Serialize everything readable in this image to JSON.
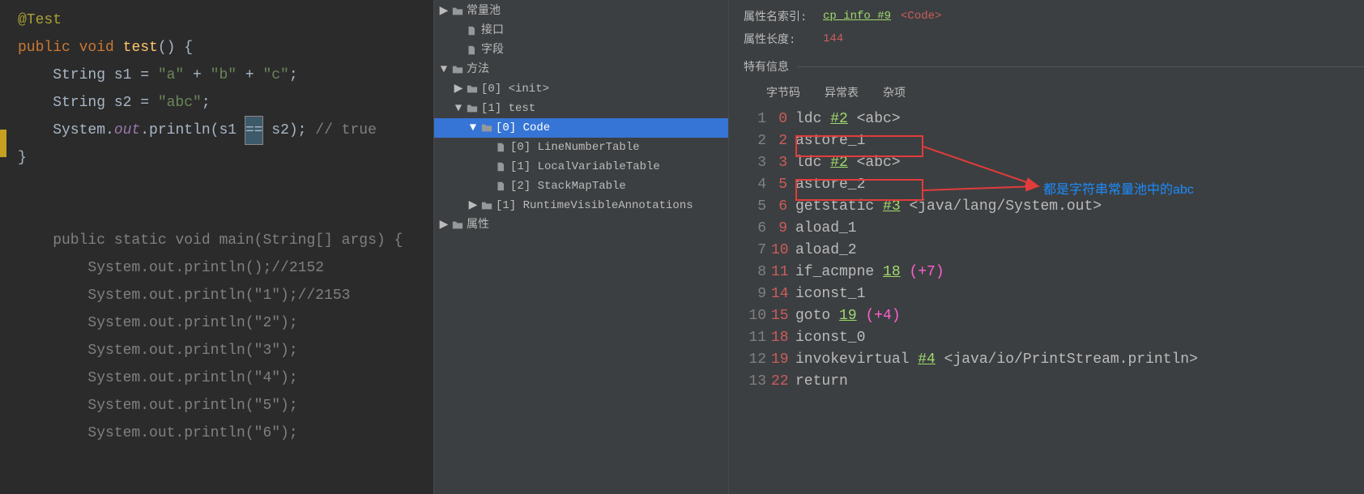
{
  "editor": {
    "lines": [
      {
        "tokens": [
          [
            "anno",
            "@Test"
          ]
        ]
      },
      {
        "tokens": [
          [
            "kw",
            "public "
          ],
          [
            "kw",
            "void "
          ],
          [
            "id",
            "test"
          ],
          [
            "punct",
            "() {"
          ]
        ]
      },
      {
        "tokens": [
          [
            "punct",
            "    String s1 = "
          ],
          [
            "str",
            "\"a\""
          ],
          [
            "punct",
            " + "
          ],
          [
            "str",
            "\"b\""
          ],
          [
            "punct",
            " + "
          ],
          [
            "str",
            "\"c\""
          ],
          [
            "punct",
            ";"
          ]
        ]
      },
      {
        "tokens": [
          [
            "punct",
            "    String s2 = "
          ],
          [
            "str",
            "\"abc\""
          ],
          [
            "punct",
            ";"
          ]
        ]
      },
      {
        "tokens": [
          [
            "punct",
            "    System."
          ],
          [
            "field",
            "out"
          ],
          [
            "punct",
            ".println(s1 "
          ],
          [
            "cursor",
            "=="
          ],
          [
            "punct",
            " s2); "
          ],
          [
            "comment",
            "// true"
          ]
        ]
      },
      {
        "tokens": [
          [
            "punct",
            "}"
          ]
        ]
      },
      {
        "tokens": []
      },
      {
        "tokens": []
      },
      {
        "tokens": [
          [
            "comment",
            "    public static void main(String[] args) {"
          ]
        ]
      },
      {
        "tokens": [
          [
            "comment",
            "        System.out.println();//2152"
          ]
        ]
      },
      {
        "tokens": [
          [
            "comment",
            "        System.out.println(\"1\");//2153"
          ]
        ]
      },
      {
        "tokens": [
          [
            "comment",
            "        System.out.println(\"2\");"
          ]
        ]
      },
      {
        "tokens": [
          [
            "comment",
            "        System.out.println(\"3\");"
          ]
        ]
      },
      {
        "tokens": [
          [
            "comment",
            "        System.out.println(\"4\");"
          ]
        ]
      },
      {
        "tokens": [
          [
            "comment",
            "        System.out.println(\"5\");"
          ]
        ]
      },
      {
        "tokens": [
          [
            "comment",
            "        System.out.println(\"6\");"
          ]
        ]
      }
    ]
  },
  "tree": {
    "items": [
      {
        "depth": 1,
        "arrow": "▶",
        "icon": "folder",
        "label": "常量池",
        "selected": false
      },
      {
        "depth": 2,
        "arrow": "",
        "icon": "file",
        "label": "接口",
        "selected": false
      },
      {
        "depth": 2,
        "arrow": "",
        "icon": "file",
        "label": "字段",
        "selected": false
      },
      {
        "depth": 1,
        "arrow": "▼",
        "icon": "folder",
        "label": "方法",
        "selected": false
      },
      {
        "depth": 2,
        "arrow": "▶",
        "icon": "folder",
        "label": "[0] <init>",
        "selected": false
      },
      {
        "depth": 2,
        "arrow": "▼",
        "icon": "folder",
        "label": "[1] test",
        "selected": false
      },
      {
        "depth": 3,
        "arrow": "▼",
        "icon": "folder",
        "label": "[0] Code",
        "selected": true
      },
      {
        "depth": 4,
        "arrow": "",
        "icon": "file",
        "label": "[0] LineNumberTable",
        "selected": false
      },
      {
        "depth": 4,
        "arrow": "",
        "icon": "file",
        "label": "[1] LocalVariableTable",
        "selected": false
      },
      {
        "depth": 4,
        "arrow": "",
        "icon": "file",
        "label": "[2] StackMapTable",
        "selected": false
      },
      {
        "depth": 3,
        "arrow": "▶",
        "icon": "folder",
        "label": "[1] RuntimeVisibleAnnotations",
        "selected": false
      },
      {
        "depth": 1,
        "arrow": "▶",
        "icon": "folder",
        "label": "属性",
        "selected": false
      }
    ]
  },
  "props": {
    "attr_index_label": "属性名索引:",
    "attr_index_cp": "cp_info #9",
    "attr_index_tag": "<Code>",
    "attr_len_label": "属性长度:",
    "attr_len_value": "144",
    "section_title": "特有信息"
  },
  "tabs": {
    "items": [
      "字节码",
      "异常表",
      "杂项"
    ]
  },
  "bytecode": {
    "rows": [
      {
        "ln": 1,
        "off": 0,
        "tokens": [
          [
            "op",
            "ldc "
          ],
          [
            "cpref",
            "#2"
          ],
          [
            "arg",
            " <abc>"
          ]
        ]
      },
      {
        "ln": 2,
        "off": 2,
        "tokens": [
          [
            "op",
            "astore_1"
          ]
        ]
      },
      {
        "ln": 3,
        "off": 3,
        "tokens": [
          [
            "op",
            "ldc "
          ],
          [
            "cpref",
            "#2"
          ],
          [
            "arg",
            " <abc>"
          ]
        ]
      },
      {
        "ln": 4,
        "off": 5,
        "tokens": [
          [
            "op",
            "astore_2"
          ]
        ]
      },
      {
        "ln": 5,
        "off": 6,
        "tokens": [
          [
            "op",
            "getstatic "
          ],
          [
            "cpref",
            "#3"
          ],
          [
            "arg",
            " <java/lang/System.out>"
          ]
        ]
      },
      {
        "ln": 6,
        "off": 9,
        "tokens": [
          [
            "op",
            "aload_1"
          ]
        ]
      },
      {
        "ln": 7,
        "off": 10,
        "tokens": [
          [
            "op",
            "aload_2"
          ]
        ]
      },
      {
        "ln": 8,
        "off": 11,
        "tokens": [
          [
            "op",
            "if_acmpne "
          ],
          [
            "jmpref",
            "18"
          ],
          [
            "arg",
            " "
          ],
          [
            "offref",
            "(+7)"
          ]
        ]
      },
      {
        "ln": 9,
        "off": 14,
        "tokens": [
          [
            "op",
            "iconst_1"
          ]
        ]
      },
      {
        "ln": 10,
        "off": 15,
        "tokens": [
          [
            "op",
            "goto "
          ],
          [
            "jmpref",
            "19"
          ],
          [
            "arg",
            " "
          ],
          [
            "offref",
            "(+4)"
          ]
        ]
      },
      {
        "ln": 11,
        "off": 18,
        "tokens": [
          [
            "op",
            "iconst_0"
          ]
        ]
      },
      {
        "ln": 12,
        "off": 19,
        "tokens": [
          [
            "op",
            "invokevirtual "
          ],
          [
            "cpref",
            "#4"
          ],
          [
            "arg",
            " <java/io/PrintStream.println>"
          ]
        ]
      },
      {
        "ln": 13,
        "off": 22,
        "tokens": [
          [
            "op",
            "return"
          ]
        ]
      }
    ]
  },
  "annotation": {
    "text": "都是字符串常量池中的abc",
    "box_color": "#e23b3b"
  }
}
